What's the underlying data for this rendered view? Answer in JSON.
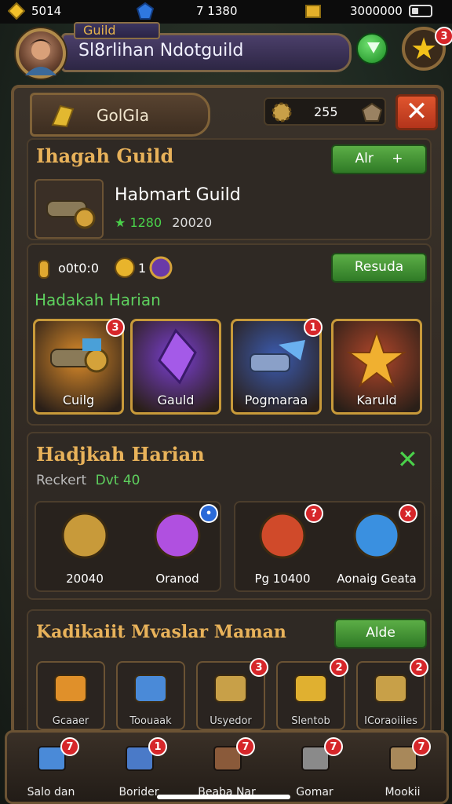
{
  "status_bar": {
    "gold": "5014",
    "gems": "7 1380",
    "crates": "3000000"
  },
  "header": {
    "guild_tag": "Guild",
    "player_name": "Sl8rlihan Ndotguild",
    "star_badge": "3"
  },
  "panel": {
    "title": "GolGIa",
    "currency_value": "255",
    "close_label": "✕"
  },
  "guild_section": {
    "title": "Ihagah Guild",
    "button_label": "Alr",
    "guild_name": "Habmart Guild",
    "stat_green": "1280",
    "stat_value": "20020"
  },
  "daily_section": {
    "ammo_value": "o0t0:0",
    "coin_value": "1",
    "rescue_label": "Resuda",
    "subtitle": "Hadakah Harian",
    "slots": [
      {
        "label": "Cuilg",
        "badge": "3",
        "color": "#d98a2a"
      },
      {
        "label": "Gauld",
        "badge": "",
        "color": "#7a3fd1"
      },
      {
        "label": "Pogmaraa",
        "badge": "1",
        "color": "#3b5bb0"
      },
      {
        "label": "Karuld",
        "badge": "",
        "color": "#b0462a"
      }
    ]
  },
  "harian_section": {
    "title": "Hadjkah Harian",
    "progress_label": "Reckert",
    "progress_value": "Dvt 40",
    "rewards": [
      {
        "label": "20040",
        "badge": ""
      },
      {
        "label": "Oranod",
        "badge": "•"
      },
      {
        "label": "Pg 10400",
        "badge": "?"
      },
      {
        "label": "Aonaig Geata",
        "badge": "x"
      }
    ]
  },
  "market_section": {
    "title": "Kadikaiit Mvaslar Maman",
    "button_label": "Alde",
    "items": [
      {
        "label": "Gcaaer",
        "badge": ""
      },
      {
        "label": "Toouaak",
        "badge": ""
      },
      {
        "label": "Usyedor",
        "badge": "3"
      },
      {
        "label": "Slentob",
        "badge": "2"
      },
      {
        "label": "ICoraoiiies",
        "badge": "2"
      }
    ]
  },
  "bottom_nav": [
    {
      "label": "Salo dan",
      "badge": "7"
    },
    {
      "label": "Borider",
      "badge": "1"
    },
    {
      "label": "Beaba Nar",
      "badge": "7"
    },
    {
      "label": "Gomar",
      "badge": "7"
    },
    {
      "label": "Mookii",
      "badge": "7"
    }
  ]
}
